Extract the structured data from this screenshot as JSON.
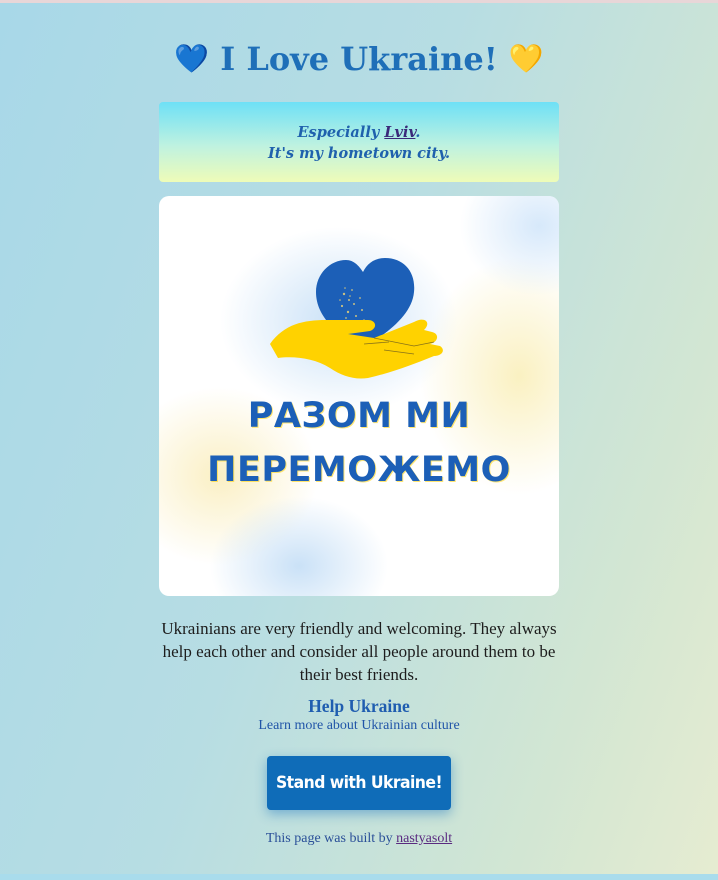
{
  "header": {
    "title": "I Love Ukraine!",
    "heart_left": "💙",
    "heart_right": "💛"
  },
  "banner": {
    "line1_prefix": "Especially ",
    "city_link": "Lviv",
    "line1_suffix": ".",
    "line2": "It's my hometown city."
  },
  "poster": {
    "slogan_line1": "РАЗОМ МИ",
    "slogan_line2": "ПЕРЕМОЖЕМО",
    "colors": {
      "blue": "#1c5fb7",
      "yellow": "#ffd200"
    }
  },
  "main": {
    "description": "Ukrainians are very friendly and welcoming. They always help each other and consider all people around them to be their best friends.",
    "help_title": "Help Ukraine",
    "help_subtitle": "Learn more about Ukrainian culture",
    "cta_label": "Stand with Ukraine!"
  },
  "footer": {
    "prefix": "This page was built by ",
    "author": "nastyasolt"
  },
  "colors": {
    "accent_blue": "#1f6fb8",
    "button": "#0f6cb8"
  }
}
